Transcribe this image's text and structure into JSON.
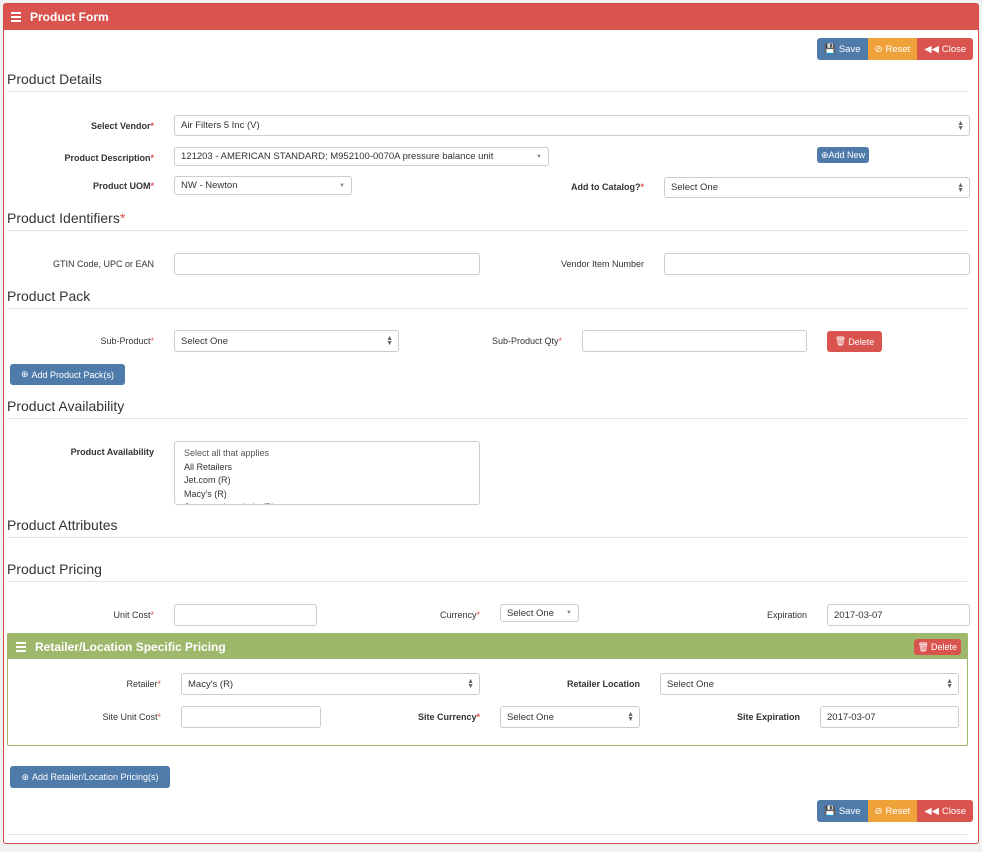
{
  "panel": {
    "title": "Product Form",
    "accent_color": "#d9534f"
  },
  "toolbar": {
    "save_label": "Save",
    "reset_label": "Reset",
    "close_label": "Close"
  },
  "sections": {
    "details": "Product Details",
    "identifiers": "Product Identifiers",
    "pack": "Product Pack",
    "availability": "Product Availability",
    "attributes": "Product Attributes",
    "pricing": "Product Pricing"
  },
  "details": {
    "vendor_label": "Select Vendor",
    "vendor_value": "Air Filters 5 Inc (V)",
    "description_label": "Product Description",
    "description_value": "121203 - AMERICAN STANDARD; M952100-0070A pressure balance unit",
    "add_new_label": "Add New",
    "uom_label": "Product UOM",
    "uom_value": "NW - Newton",
    "catalog_label": "Add to Catalog?",
    "catalog_value": "Select One"
  },
  "identifiers": {
    "gtin_label": "GTIN Code, UPC or EAN",
    "gtin_value": "",
    "vendor_item_label": "Vendor Item Number",
    "vendor_item_value": ""
  },
  "pack": {
    "sub_product_label": "Sub-Product",
    "sub_product_value": "Select One",
    "sub_product_qty_label": "Sub-Product Qty",
    "sub_product_qty_value": "",
    "delete_label": "Delete",
    "add_pack_label": "Add Product Pack(s)"
  },
  "availability": {
    "label": "Product Availability",
    "options": [
      "Select all that applies",
      "All Retailers",
      "Jet.com (R)",
      "Macy's (R)",
      "Supermarket chain (R)"
    ]
  },
  "pricing": {
    "unit_cost_label": "Unit Cost",
    "unit_cost_value": "",
    "currency_label": "Currency",
    "currency_value": "Select One",
    "expiration_label": "Expiration",
    "expiration_value": "2017-03-07"
  },
  "retailer_pricing": {
    "title": "Retailer/Location Specific Pricing",
    "header_color": "#9db86b",
    "delete_label": "Delete",
    "retailer_label": "Retailer",
    "retailer_value": "Macy's (R)",
    "location_label": "Retailer Location",
    "location_value": "Select One",
    "site_unit_cost_label": "Site Unit Cost",
    "site_unit_cost_value": "",
    "site_currency_label": "Site Currency",
    "site_currency_value": "Select One",
    "site_expiration_label": "Site Expiration",
    "site_expiration_value": "2017-03-07",
    "add_label": "Add Retailer/Location Pricing(s)"
  },
  "required_marker": "*",
  "icons": {
    "menu": "hamburger-icon",
    "save": "floppy-disk-icon",
    "reset": "ban-icon",
    "close": "backward-icon",
    "add": "plus-circle-icon",
    "delete": "trash-icon"
  }
}
